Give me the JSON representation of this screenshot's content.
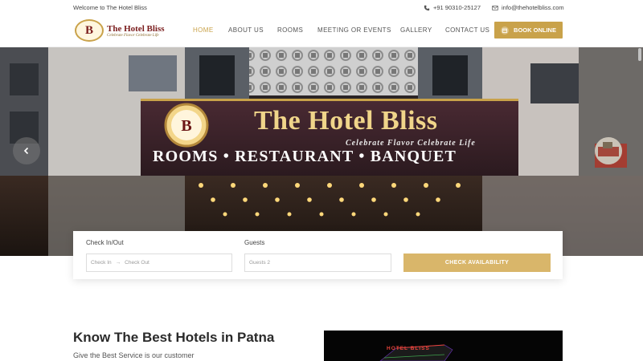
{
  "topbar": {
    "welcome": "Welcome to The Hotel Bliss",
    "phone": "+91 90310-25127",
    "email": "info@thehotelbliss.com",
    "phone_icon": "phone-icon",
    "email_icon": "envelope-icon"
  },
  "logo": {
    "letter": "B",
    "name": "The Hotel Bliss",
    "tagline": "Celebrate Flavor Celebrate Life"
  },
  "nav": {
    "items": [
      {
        "label": "HOME",
        "active": true
      },
      {
        "label": "ABOUT US",
        "active": false
      },
      {
        "label": "ROOMS",
        "active": false
      },
      {
        "label": "MEETING OR EVENTS",
        "active": false
      },
      {
        "label": "GALLERY",
        "active": false
      },
      {
        "label": "CONTACT US",
        "active": false
      }
    ],
    "book_label": "BOOK ONLINE"
  },
  "hero": {
    "sign_title": "The Hotel Bliss",
    "sign_tagline": "Celebrate Flavor Celebrate Life",
    "sign_subtitle": "ROOMS • RESTAURANT • BANQUET",
    "prev_icon": "chevron-left-icon",
    "next_icon": "thumbnail-next"
  },
  "booking": {
    "checkin_label": "Check In/Out",
    "checkin_placeholder": "Check In",
    "checkout_placeholder": "Check Out",
    "guests_label": "Guests",
    "guests_placeholder": "Guests 2",
    "button_label": "CHECK AVAILABILITY"
  },
  "about": {
    "title": "Know The Best Hotels in Patna",
    "subtitle": "Give the Best Service is our customer",
    "image_text": "HOTEL BLISS"
  },
  "colors": {
    "accent": "#c9a24a",
    "accent_light": "#d9b66a",
    "brand": "#7a1c1c"
  }
}
